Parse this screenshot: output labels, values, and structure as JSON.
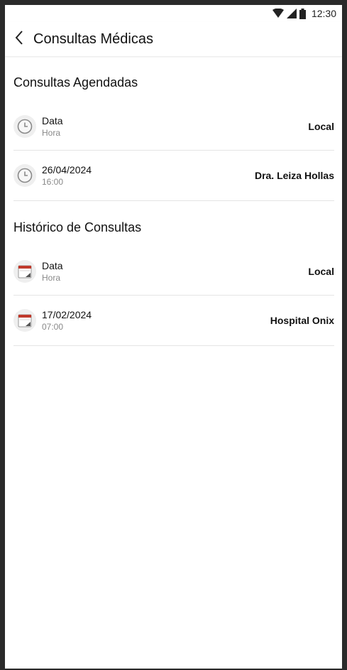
{
  "status_bar": {
    "time": "12:30",
    "icons": [
      "wifi-icon",
      "signal-icon",
      "battery-icon"
    ]
  },
  "app_bar": {
    "back_icon": "chevron-left-icon",
    "title": "Consultas Médicas"
  },
  "scheduled": {
    "title": "Consultas Agendadas",
    "items": [
      {
        "date": "Data",
        "time": "Hora",
        "location": "Local",
        "icon": "clock-icon"
      },
      {
        "date": "26/04/2024",
        "time": "16:00",
        "location": "Dra. Leiza Hollas",
        "icon": "clock-icon"
      }
    ]
  },
  "history": {
    "title": "Histórico de Consultas",
    "items": [
      {
        "date": "Data",
        "time": "Hora",
        "location": "Local",
        "icon": "calendar-icon"
      },
      {
        "date": "17/02/2024",
        "time": "07:00",
        "location": "Hospital Onix",
        "icon": "calendar-icon"
      }
    ]
  },
  "colors": {
    "frame": "#2a2a2a",
    "background": "#ffffff",
    "divider": "#e4e4e4",
    "icon_bg": "#efefef",
    "calendar_red": "#c0392b",
    "secondary_text": "#888888"
  }
}
